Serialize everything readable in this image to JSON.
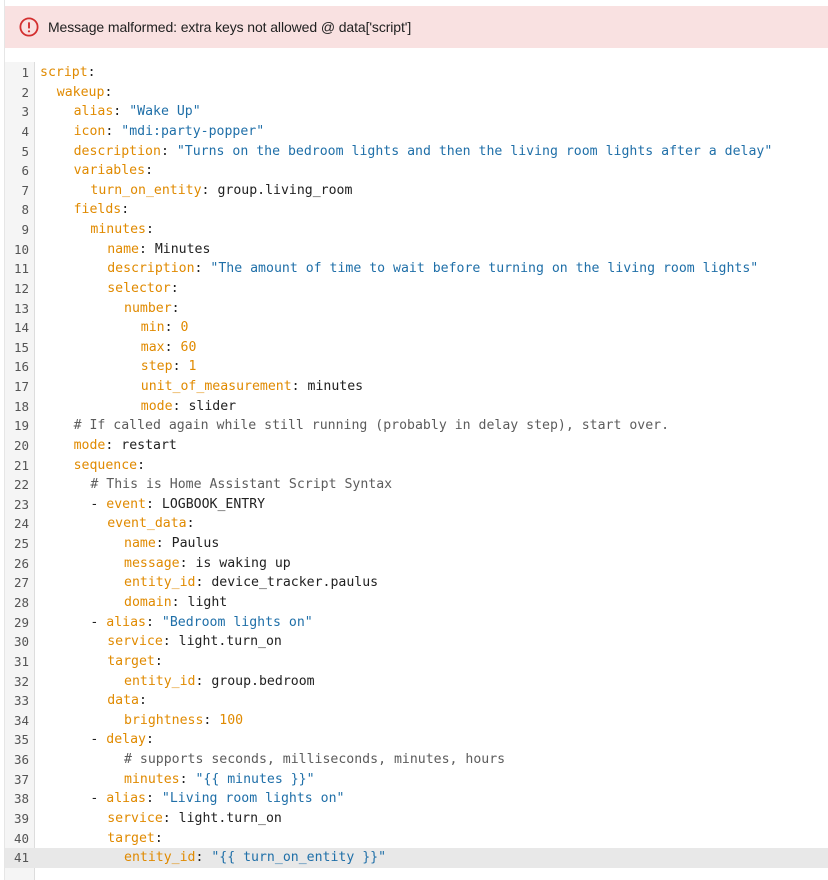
{
  "error": {
    "icon": "alert-circle-icon",
    "message": "Message malformed: extra keys not allowed @ data['script']",
    "color": "#d32f2f",
    "background": "#f9e1e1"
  },
  "editor": {
    "active_line": 41,
    "lines": [
      {
        "n": "1",
        "indent": 0,
        "tokens": [
          [
            "key",
            "script"
          ],
          [
            "punct",
            ":"
          ]
        ]
      },
      {
        "n": "2",
        "indent": 1,
        "tokens": [
          [
            "key",
            "wakeup"
          ],
          [
            "punct",
            ":"
          ]
        ]
      },
      {
        "n": "3",
        "indent": 2,
        "tokens": [
          [
            "key",
            "alias"
          ],
          [
            "punct",
            ": "
          ],
          [
            "str",
            "\"Wake Up\""
          ]
        ]
      },
      {
        "n": "4",
        "indent": 2,
        "tokens": [
          [
            "key",
            "icon"
          ],
          [
            "punct",
            ": "
          ],
          [
            "str",
            "\"mdi:party-popper\""
          ]
        ]
      },
      {
        "n": "5",
        "indent": 2,
        "tokens": [
          [
            "key",
            "description"
          ],
          [
            "punct",
            ": "
          ],
          [
            "str",
            "\"Turns on the bedroom lights and then the living room lights after a delay\""
          ]
        ]
      },
      {
        "n": "6",
        "indent": 2,
        "tokens": [
          [
            "key",
            "variables"
          ],
          [
            "punct",
            ":"
          ]
        ]
      },
      {
        "n": "7",
        "indent": 3,
        "tokens": [
          [
            "key",
            "turn_on_entity"
          ],
          [
            "punct",
            ": "
          ],
          [
            "plain",
            "group.living_room"
          ]
        ]
      },
      {
        "n": "8",
        "indent": 2,
        "tokens": [
          [
            "key",
            "fields"
          ],
          [
            "punct",
            ":"
          ]
        ]
      },
      {
        "n": "9",
        "indent": 3,
        "tokens": [
          [
            "key",
            "minutes"
          ],
          [
            "punct",
            ":"
          ]
        ]
      },
      {
        "n": "10",
        "indent": 4,
        "tokens": [
          [
            "key",
            "name"
          ],
          [
            "punct",
            ": "
          ],
          [
            "plain",
            "Minutes"
          ]
        ]
      },
      {
        "n": "11",
        "indent": 4,
        "tokens": [
          [
            "key",
            "description"
          ],
          [
            "punct",
            ": "
          ],
          [
            "str",
            "\"The amount of time to wait before turning on the living room lights\""
          ]
        ]
      },
      {
        "n": "12",
        "indent": 4,
        "tokens": [
          [
            "key",
            "selector"
          ],
          [
            "punct",
            ":"
          ]
        ]
      },
      {
        "n": "13",
        "indent": 5,
        "tokens": [
          [
            "key",
            "number"
          ],
          [
            "punct",
            ":"
          ]
        ]
      },
      {
        "n": "14",
        "indent": 6,
        "tokens": [
          [
            "key",
            "min"
          ],
          [
            "punct",
            ": "
          ],
          [
            "num",
            "0"
          ]
        ]
      },
      {
        "n": "15",
        "indent": 6,
        "tokens": [
          [
            "key",
            "max"
          ],
          [
            "punct",
            ": "
          ],
          [
            "num",
            "60"
          ]
        ]
      },
      {
        "n": "16",
        "indent": 6,
        "tokens": [
          [
            "key",
            "step"
          ],
          [
            "punct",
            ": "
          ],
          [
            "num",
            "1"
          ]
        ]
      },
      {
        "n": "17",
        "indent": 6,
        "tokens": [
          [
            "key",
            "unit_of_measurement"
          ],
          [
            "punct",
            ": "
          ],
          [
            "plain",
            "minutes"
          ]
        ]
      },
      {
        "n": "18",
        "indent": 6,
        "tokens": [
          [
            "key",
            "mode"
          ],
          [
            "punct",
            ": "
          ],
          [
            "plain",
            "slider"
          ]
        ]
      },
      {
        "n": "19",
        "indent": 2,
        "tokens": [
          [
            "comment",
            "# If called again while still running (probably in delay step), start over."
          ]
        ]
      },
      {
        "n": "20",
        "indent": 2,
        "tokens": [
          [
            "key",
            "mode"
          ],
          [
            "punct",
            ": "
          ],
          [
            "plain",
            "restart"
          ]
        ]
      },
      {
        "n": "21",
        "indent": 2,
        "tokens": [
          [
            "key",
            "sequence"
          ],
          [
            "punct",
            ":"
          ]
        ]
      },
      {
        "n": "22",
        "indent": 3,
        "tokens": [
          [
            "comment",
            "# This is Home Assistant Script Syntax"
          ]
        ]
      },
      {
        "n": "23",
        "indent": 3,
        "tokens": [
          [
            "dash",
            "- "
          ],
          [
            "key",
            "event"
          ],
          [
            "punct",
            ": "
          ],
          [
            "plain",
            "LOGBOOK_ENTRY"
          ]
        ]
      },
      {
        "n": "24",
        "indent": 4,
        "tokens": [
          [
            "key",
            "event_data"
          ],
          [
            "punct",
            ":"
          ]
        ]
      },
      {
        "n": "25",
        "indent": 5,
        "tokens": [
          [
            "key",
            "name"
          ],
          [
            "punct",
            ": "
          ],
          [
            "plain",
            "Paulus"
          ]
        ]
      },
      {
        "n": "26",
        "indent": 5,
        "tokens": [
          [
            "key",
            "message"
          ],
          [
            "punct",
            ": "
          ],
          [
            "plain",
            "is waking up"
          ]
        ]
      },
      {
        "n": "27",
        "indent": 5,
        "tokens": [
          [
            "key",
            "entity_id"
          ],
          [
            "punct",
            ": "
          ],
          [
            "plain",
            "device_tracker.paulus"
          ]
        ]
      },
      {
        "n": "28",
        "indent": 5,
        "tokens": [
          [
            "key",
            "domain"
          ],
          [
            "punct",
            ": "
          ],
          [
            "plain",
            "light"
          ]
        ]
      },
      {
        "n": "29",
        "indent": 3,
        "tokens": [
          [
            "dash",
            "- "
          ],
          [
            "key",
            "alias"
          ],
          [
            "punct",
            ": "
          ],
          [
            "str",
            "\"Bedroom lights on\""
          ]
        ]
      },
      {
        "n": "30",
        "indent": 4,
        "tokens": [
          [
            "key",
            "service"
          ],
          [
            "punct",
            ": "
          ],
          [
            "plain",
            "light.turn_on"
          ]
        ]
      },
      {
        "n": "31",
        "indent": 4,
        "tokens": [
          [
            "key",
            "target"
          ],
          [
            "punct",
            ":"
          ]
        ]
      },
      {
        "n": "32",
        "indent": 5,
        "tokens": [
          [
            "key",
            "entity_id"
          ],
          [
            "punct",
            ": "
          ],
          [
            "plain",
            "group.bedroom"
          ]
        ]
      },
      {
        "n": "33",
        "indent": 4,
        "tokens": [
          [
            "key",
            "data"
          ],
          [
            "punct",
            ":"
          ]
        ]
      },
      {
        "n": "34",
        "indent": 5,
        "tokens": [
          [
            "key",
            "brightness"
          ],
          [
            "punct",
            ": "
          ],
          [
            "num",
            "100"
          ]
        ]
      },
      {
        "n": "35",
        "indent": 3,
        "tokens": [
          [
            "dash",
            "- "
          ],
          [
            "key",
            "delay"
          ],
          [
            "punct",
            ":"
          ]
        ]
      },
      {
        "n": "36",
        "indent": 5,
        "tokens": [
          [
            "comment",
            "# supports seconds, milliseconds, minutes, hours"
          ]
        ]
      },
      {
        "n": "37",
        "indent": 5,
        "tokens": [
          [
            "key",
            "minutes"
          ],
          [
            "punct",
            ": "
          ],
          [
            "str",
            "\"{{ minutes }}\""
          ]
        ]
      },
      {
        "n": "38",
        "indent": 3,
        "tokens": [
          [
            "dash",
            "- "
          ],
          [
            "key",
            "alias"
          ],
          [
            "punct",
            ": "
          ],
          [
            "str",
            "\"Living room lights on\""
          ]
        ]
      },
      {
        "n": "39",
        "indent": 4,
        "tokens": [
          [
            "key",
            "service"
          ],
          [
            "punct",
            ": "
          ],
          [
            "plain",
            "light.turn_on"
          ]
        ]
      },
      {
        "n": "40",
        "indent": 4,
        "tokens": [
          [
            "key",
            "target"
          ],
          [
            "punct",
            ":"
          ]
        ]
      },
      {
        "n": "41",
        "indent": 5,
        "tokens": [
          [
            "key",
            "entity_id"
          ],
          [
            "punct",
            ": "
          ],
          [
            "str",
            "\"{{ turn_on_entity }}\""
          ]
        ]
      }
    ]
  }
}
